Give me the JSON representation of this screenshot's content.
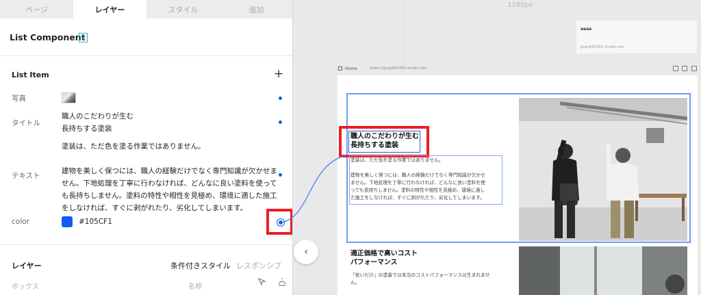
{
  "tabs": [
    "ページ",
    "レイヤー",
    "スタイル",
    "追加"
  ],
  "component": {
    "title": "List Component",
    "badge": "0"
  },
  "list_item": {
    "title": "List Item",
    "add_icon": "plus-icon",
    "photo_label": "写真",
    "title_label": "タイトル",
    "title_lines": [
      "職人のこだわりが生む",
      "長持ちする塗装"
    ],
    "text_label": "テキスト",
    "text_lines": [
      "塗装は、ただ色を塗る作業ではありません。",
      "",
      "建物を美しく保つには、職人の経験だけでなく専門知識が欠かせま",
      "せん。下地処理を丁寧に行わなければ、どんなに良い塗料を使って",
      "も長持ちしません。塗料の特性や相性を見極め、環境に適した施工",
      "をしなければ、すぐに剥がれたり、劣化してしまいます。"
    ],
    "color_label": "color",
    "color_value": "#105CF1"
  },
  "bottom": {
    "layer_tab": "レイヤー",
    "conditional_tab": "条件付きスタイル",
    "responsive_tab": "レスポンシブ",
    "box_col": "ボックス",
    "name_col": "名称"
  },
  "canvas": {
    "ruler": "1280px",
    "thumb_title": "aaaa",
    "thumb_url": "gray645282.studio.site",
    "home": "Home",
    "url": "https://gray645282.studio.site"
  },
  "preview": {
    "title_lines": [
      "職人のこだわりが生む",
      "長持ちする塗装"
    ],
    "text_lines": [
      "塗装は、ただ色を塗る作業ではありません。",
      "",
      "建物を美しく保つには、職人の経験だけでなく専門知識が欠かせ",
      "ません。下地処理を丁寧に行わなければ、どんなに良い塗料を使",
      "っても長持ちしません。塗料の特性や相性を見極め、環境に適し",
      "た施工をしなければ、すぐに剥がれたり、劣化してしまいます。"
    ],
    "title2_lines": [
      "適正価格で高いコスト",
      "パフォーマンス"
    ],
    "text2": "「安いだけ」の塗装では本当のコストパフォーマンスは生まれませ",
    "text2b": "ん。"
  },
  "colors": {
    "accent": "#105CF1",
    "highlight": "#ee1d23",
    "badge": "#27b6c4"
  }
}
